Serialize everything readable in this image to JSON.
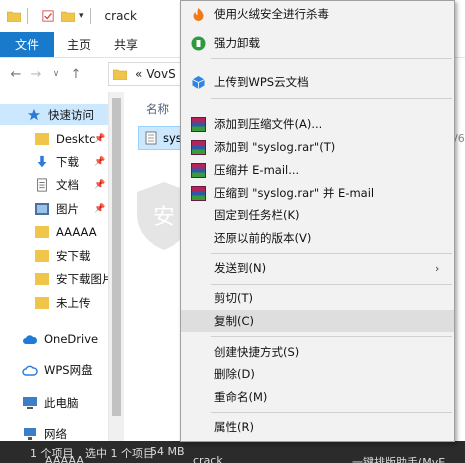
{
  "window": {
    "title": "crack",
    "tabs": [
      {
        "label": "文件",
        "active": true
      },
      {
        "label": "主页",
        "active": false
      },
      {
        "label": "共享",
        "active": false
      }
    ]
  },
  "address": {
    "prefix": "«",
    "path": "VovS"
  },
  "sidebar": {
    "items": [
      {
        "label": "快速访问",
        "icon": "star-icon",
        "selected": true,
        "pinned": false
      },
      {
        "label": "Desktc",
        "icon": "folder-icon",
        "selected": false,
        "pinned": true
      },
      {
        "label": "下载",
        "icon": "download-icon",
        "selected": false,
        "pinned": true
      },
      {
        "label": "文档",
        "icon": "document-icon",
        "selected": false,
        "pinned": true
      },
      {
        "label": "图片",
        "icon": "picture-icon",
        "selected": false,
        "pinned": true
      },
      {
        "label": "AAAAA",
        "icon": "folder-icon",
        "selected": false,
        "pinned": false
      },
      {
        "label": "安下载",
        "icon": "folder-icon",
        "selected": false,
        "pinned": false
      },
      {
        "label": "安下载图片",
        "icon": "folder-icon",
        "selected": false,
        "pinned": false
      },
      {
        "label": "未上传",
        "icon": "folder-icon",
        "selected": false,
        "pinned": false
      },
      {
        "label": "OneDrive",
        "icon": "cloud-icon",
        "selected": false,
        "pinned": false
      },
      {
        "label": "WPS网盘",
        "icon": "cloud-icon",
        "selected": false,
        "pinned": false
      },
      {
        "label": "此电脑",
        "icon": "computer-icon",
        "selected": false,
        "pinned": false
      },
      {
        "label": "网络",
        "icon": "network-icon",
        "selected": false,
        "pinned": false
      }
    ]
  },
  "content": {
    "column_name": "名称",
    "file_name": "sysl",
    "right_fragment": "/6"
  },
  "statusbar": {
    "count": "1 个项目",
    "selected": "选中 1 个项目",
    "size": "54 MB",
    "taskbar_items": [
      "AAAAA",
      "crack",
      "一键排版助手(MyE"
    ]
  },
  "context_menu": {
    "items": [
      {
        "label": "使用火绒安全进行杀毒",
        "icon": "huorong-icon"
      },
      {
        "label": "强力卸载",
        "icon": "uninstall-icon"
      },
      {
        "sep": true
      },
      {
        "label": "上传到WPS云文档",
        "icon": "wps-cloud-icon"
      },
      {
        "sep": true
      },
      {
        "label": "添加到压缩文件(A)...",
        "icon": "winrar-icon"
      },
      {
        "label": "添加到 \"syslog.rar\"(T)",
        "icon": "winrar-icon"
      },
      {
        "label": "压缩并 E-mail...",
        "icon": "winrar-icon"
      },
      {
        "label": "压缩到 \"syslog.rar\" 并 E-mail",
        "icon": "winrar-icon"
      },
      {
        "label": "固定到任务栏(K)",
        "icon": ""
      },
      {
        "label": "还原以前的版本(V)",
        "icon": ""
      },
      {
        "sep": true
      },
      {
        "label": "发送到(N)",
        "icon": "",
        "submenu": true
      },
      {
        "sep": true
      },
      {
        "label": "剪切(T)",
        "icon": ""
      },
      {
        "label": "复制(C)",
        "icon": "",
        "hover": true
      },
      {
        "sep": true
      },
      {
        "label": "创建快捷方式(S)",
        "icon": ""
      },
      {
        "label": "删除(D)",
        "icon": ""
      },
      {
        "label": "重命名(M)",
        "icon": ""
      },
      {
        "sep": true
      },
      {
        "label": "属性(R)",
        "icon": ""
      }
    ]
  },
  "colors": {
    "accent": "#1979ca",
    "selection": "#cce8ff",
    "menu_bg": "#f2f2f2",
    "taskbar": "#2b2b2b"
  }
}
